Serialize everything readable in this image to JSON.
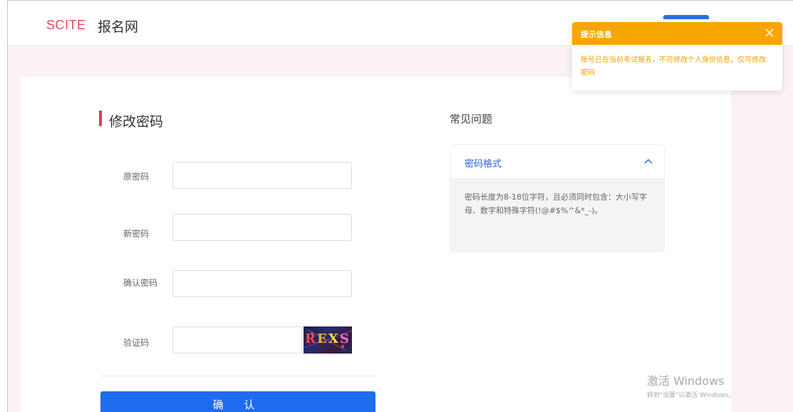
{
  "header": {
    "brand_en": "SCITE",
    "brand_zh": "报名网"
  },
  "form": {
    "title": "修改密码",
    "fields": [
      {
        "label": "原密码",
        "value": "",
        "placeholder": ""
      },
      {
        "label": "新密码",
        "value": "",
        "placeholder": ""
      },
      {
        "label": "确认密码",
        "value": "",
        "placeholder": ""
      },
      {
        "label": "验证码",
        "value": "",
        "placeholder": ""
      }
    ],
    "captcha_text": [
      "R",
      "E",
      "X",
      "S"
    ],
    "confirm_label": "确 认"
  },
  "faq": {
    "title": "常见问题",
    "items": [
      {
        "question": "密码格式",
        "answer": "密码长度为8-18位字符，且必须同时包含：大小写字母、数字和特殊字符(!@#$%^&*_-)。"
      }
    ]
  },
  "toast": {
    "title": "提示信息",
    "message": "账号已在当前考试报名，不可修改个人身份信息，仅可修改密码"
  },
  "watermark": {
    "title": "激活 Windows",
    "subtitle": "转到\"设置\"以激活 Windows。"
  },
  "colors": {
    "brand": "#e7475f",
    "primary": "#1e6cf0",
    "toast": "#f7a600",
    "link": "#2a62d8"
  },
  "icons": {
    "faq_toggle": "chevron-up-icon",
    "toast_close": "close-icon"
  }
}
